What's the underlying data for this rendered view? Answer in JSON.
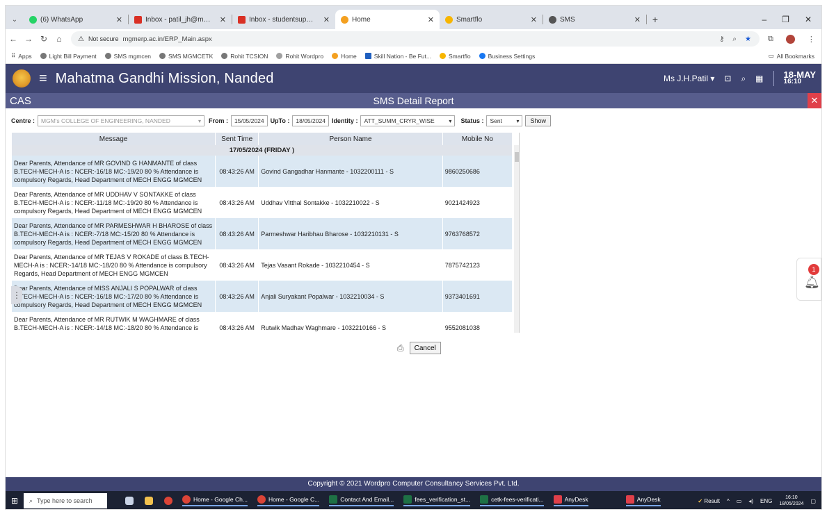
{
  "browser": {
    "tabs": [
      {
        "label": "(6) WhatsApp",
        "color": "#25d366",
        "active": false
      },
      {
        "label": "Inbox - patil_jh@mgmcen.ac.in",
        "color": "#d93025",
        "active": false
      },
      {
        "label": "Inbox - studentsupport@mgm",
        "color": "#d93025",
        "active": false
      },
      {
        "label": "Home",
        "color": "#f4a020",
        "active": true
      },
      {
        "label": "Smartflo",
        "color": "#f7b500",
        "active": false
      },
      {
        "label": "SMS",
        "color": "#555555",
        "active": false
      }
    ],
    "security_label": "Not secure",
    "url": "mgmerp.ac.in/ERP_Main.aspx",
    "bookmarks": [
      "Apps",
      "Light Bill Payment",
      "SMS mgmcen",
      "SMS MGMCETK",
      "Rohit TCSION",
      "Rohit Wordpro",
      "Home",
      "Skill Nation - Be Fut...",
      "Smartflo",
      "Business Settings"
    ],
    "all_bookmarks": "All Bookmarks"
  },
  "app": {
    "title": "Mahatma Gandhi Mission, Nanded",
    "user": "Ms J.H.Patil",
    "date_day": "18-MAY",
    "date_time": "16:10",
    "module": "CAS",
    "report_title": "SMS Detail Report"
  },
  "filters": {
    "centre_label": "Centre :",
    "centre_value": "MGM's COLLEGE OF ENGINEERING, NANDED",
    "from_label": "From :",
    "from_value": "15/05/2024",
    "upto_label": "UpTo :",
    "upto_value": "18/05/2024",
    "identity_label": "Identity :",
    "identity_value": "ATT_SUMM_CRYR_WISE",
    "status_label": "Status :",
    "status_value": "Sent",
    "show_label": "Show"
  },
  "table": {
    "headers": [
      "Message",
      "Sent Time",
      "Person Name",
      "Mobile No"
    ],
    "date_group": "17/05/2024 (FRIDAY )",
    "rows": [
      {
        "message": "Dear Parents, Attendance of MR GOVIND G HANMANTE of class B.TECH-MECH-A is : NCER:-16/18 MC:-19/20 80 % Attendance is compulsory Regards, Head Department of MECH ENGG MGMCEN",
        "time": "08:43:26 AM",
        "person": "Govind Gangadhar Hanmante - 1032200111 - S",
        "mobile": "9860250686"
      },
      {
        "message": "Dear Parents, Attendance of MR UDDHAV V SONTAKKE of class B.TECH-MECH-A is : NCER:-11/18 MC:-19/20 80 % Attendance is compulsory Regards, Head Department of MECH ENGG MGMCEN",
        "time": "08:43:26 AM",
        "person": "Uddhav Vitthal Sontakke - 1032210022 - S",
        "mobile": "9021424923"
      },
      {
        "message": "Dear Parents, Attendance of MR PARMESHWAR H BHAROSE of class B.TECH-MECH-A is : NCER:-7/18 MC:-15/20 80 % Attendance is compulsory Regards, Head Department of MECH ENGG MGMCEN",
        "time": "08:43:26 AM",
        "person": "Parmeshwar Haribhau Bharose - 1032210131 - S",
        "mobile": "9763768572"
      },
      {
        "message": "Dear Parents, Attendance of MR TEJAS V ROKADE of class B.TECH-MECH-A is : NCER:-14/18 MC:-18/20 80 % Attendance is compulsory Regards, Head Department of MECH ENGG MGMCEN",
        "time": "08:43:26 AM",
        "person": "Tejas Vasant Rokade - 1032210454 - S",
        "mobile": "7875742123"
      },
      {
        "message": "Dear Parents, Attendance of MISS ANJALI S POPALWAR of class B.TECH-MECH-A is : NCER:-16/18 MC:-17/20 80 % Attendance is compulsory Regards, Head Department of MECH ENGG MGMCEN",
        "time": "08:43:26 AM",
        "person": "Anjali Suryakant Popalwar - 1032210034 - S",
        "mobile": "9373401691"
      },
      {
        "message": "Dear Parents, Attendance of MR RUTWIK M WAGHMARE of class B.TECH-MECH-A is : NCER:-14/18 MC:-18/20 80 % Attendance is compulsory Regards, Head Department of MECH ENGG MGMCEN",
        "time": "08:43:26 AM",
        "person": "Rutwik Madhav Waghmare - 1032210166 - S",
        "mobile": "9552081038"
      }
    ]
  },
  "actions": {
    "cancel_label": "Cancel"
  },
  "notification_count": "1",
  "footer": {
    "copyright": "Copyright © 2021 Wordpro Computer Consultancy Services Pvt. Ltd."
  },
  "taskbar": {
    "search_placeholder": "Type here to search",
    "apps": [
      "Home - Google Ch...",
      "Home - Google C...",
      "Contact And Email...",
      "fees_verification_st...",
      "cetk-fees-verificati...",
      "AnyDesk",
      "AnyDesk"
    ],
    "result_label": "Result",
    "lang": "ENG",
    "time": "16:10",
    "date": "18/05/2024"
  },
  "colors": {
    "header_bg": "#3e4471",
    "subheader_bg": "#575d8d",
    "row_alt": "#dbe8f3",
    "close_red": "#e0404a"
  }
}
